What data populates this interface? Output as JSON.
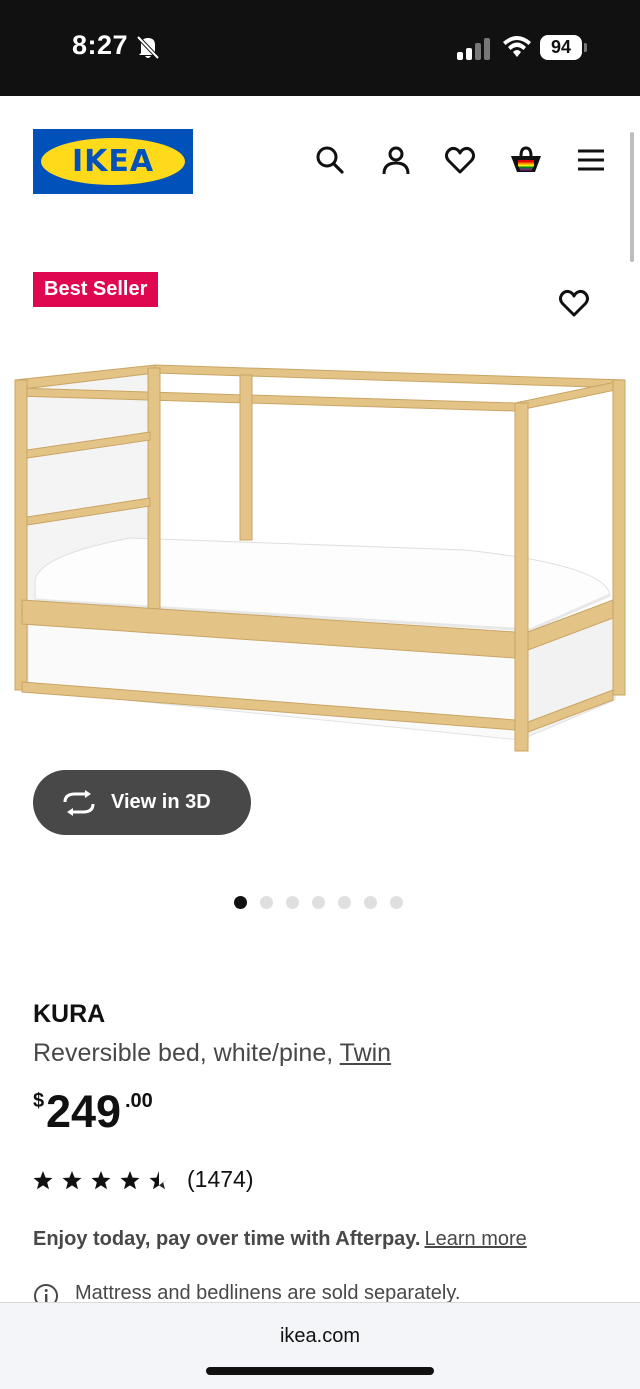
{
  "status_bar": {
    "time": "8:27",
    "battery": "94"
  },
  "header": {
    "logo_text": "IKEA",
    "icons": [
      "search-icon",
      "account-icon",
      "heart-icon",
      "shopping-bag-icon",
      "menu-icon"
    ]
  },
  "product": {
    "badge": "Best Seller",
    "view_3d_label": "View in 3D",
    "carousel": {
      "total": 7,
      "active_index": 0
    },
    "name": "KURA",
    "description": "Reversible bed, white/pine, ",
    "size_link": "Twin",
    "price": {
      "currency": "$",
      "integer": "249",
      "decimal": ".00"
    },
    "rating": {
      "value": 4.5,
      "max": 5,
      "count_text": "(1474)"
    },
    "afterpay_text": "Enjoy today, pay over time with Afterpay.",
    "afterpay_link": "Learn more",
    "note": "Mattress and bedlinens are sold separately."
  },
  "browser": {
    "url": "ikea.com"
  },
  "colors": {
    "badge": "#e00751",
    "logo_blue": "#0051ba",
    "logo_yellow": "#ffda1a",
    "button_3d": "#484848"
  }
}
